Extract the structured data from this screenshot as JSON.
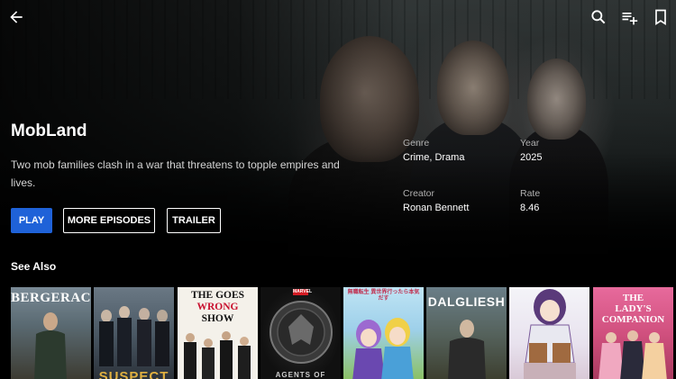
{
  "show": {
    "title": "MobLand",
    "description": "Two mob families clash in a war that threatens to topple empires and lives."
  },
  "meta": {
    "genre_label": "Genre",
    "genre_value": "Crime, Drama",
    "year_label": "Year",
    "year_value": "2025",
    "creator_label": "Creator",
    "creator_value": "Ronan Bennett",
    "rate_label": "Rate",
    "rate_value": "8.46"
  },
  "actions": {
    "play": "PLAY",
    "more_episodes": "MORE EPISODES",
    "trailer": "TRAILER"
  },
  "see_also": {
    "heading": "See Also",
    "posters": [
      {
        "title": "BERGERAC"
      },
      {
        "title": "SUSPECT"
      },
      {
        "title_line1": "THE GOES",
        "title_line2": "WRONG",
        "title_line3": "SHOW"
      },
      {
        "title": "AGENTS OF",
        "badge": "MARVEL"
      },
      {
        "title": "無職転生 異世界行ったら本気だす"
      },
      {
        "title": "DALGLIESH"
      },
      {
        "title": ""
      },
      {
        "title_line1": "THE",
        "title_line2": "LADY'S",
        "title_line3": "COMPANION"
      }
    ]
  },
  "icons": {
    "back": "back-arrow-icon",
    "search": "search-icon",
    "add_to_playlist": "playlist-add-icon",
    "bookmark": "bookmark-icon"
  },
  "colors": {
    "accent": "#1f62d8",
    "background": "#000000"
  }
}
